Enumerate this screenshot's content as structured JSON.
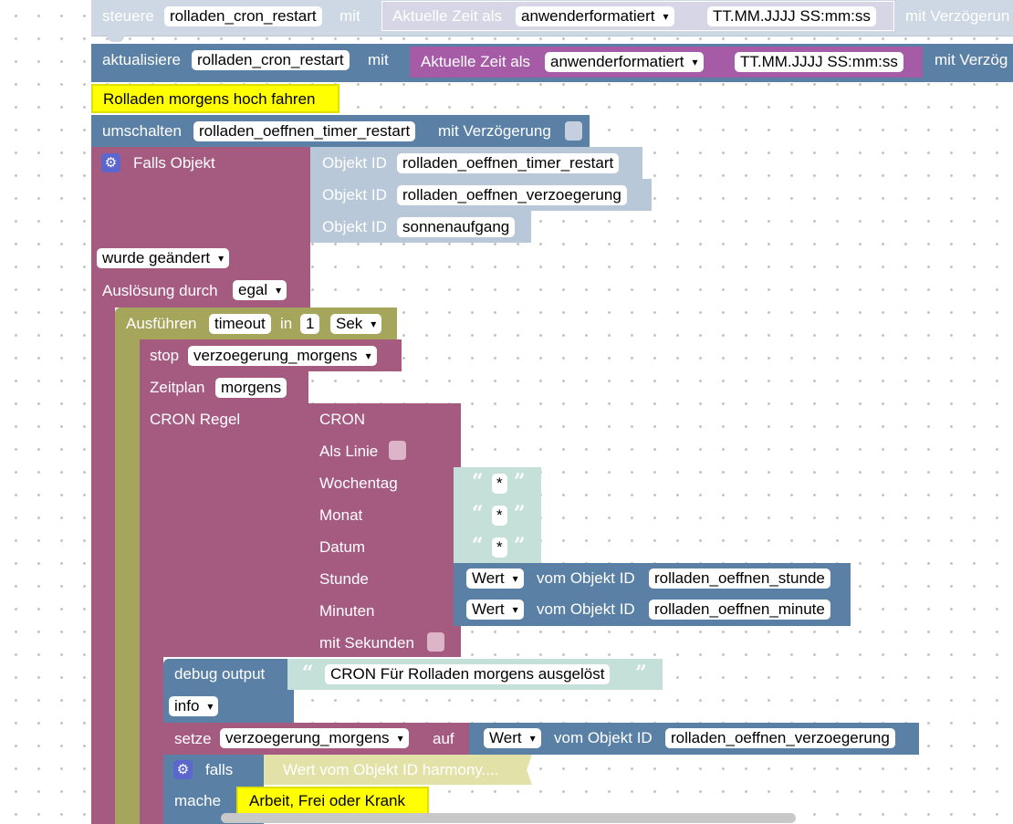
{
  "steuere_block": {
    "label": "steuere",
    "variable": "rolladen_cron_restart",
    "mit": "mit",
    "time_label": "Aktuelle Zeit als",
    "format_dropdown": "anwenderformatiert",
    "format_value": "TT.MM.JJJJ SS:mm:ss",
    "delay_label": "mit Verzögerun"
  },
  "aktualisiere_block": {
    "label": "aktualisiere",
    "variable": "rolladen_cron_restart",
    "mit": "mit",
    "time_label": "Aktuelle Zeit als",
    "format_dropdown": "anwenderformatiert",
    "format_value": "TT.MM.JJJJ SS:mm:ss",
    "delay_label": "mit Verzög"
  },
  "comment_1": "Rolladen morgens hoch fahren",
  "umschalten_block": {
    "label": "umschalten",
    "variable": "rolladen_oeffnen_timer_restart",
    "delay_label": "mit Verzögerung"
  },
  "falls_objekt_block": {
    "label": "Falls Objekt",
    "objekt_id_label": "Objekt ID",
    "ids": [
      "rolladen_oeffnen_timer_restart",
      "rolladen_oeffnen_verzoegerung",
      "sonnenaufgang"
    ],
    "trigger_dropdown": "wurde geändert",
    "ausloesung_label": "Auslösung durch",
    "ausloesung_dropdown": "egal"
  },
  "ausfuehren_block": {
    "label": "Ausführen",
    "timer_name": "timeout",
    "in_label": "in",
    "amount": "1",
    "unit_dropdown": "Sek"
  },
  "stop_block": {
    "label": "stop",
    "variable_dropdown": "verzoegerung_morgens"
  },
  "zeitplan_block": {
    "label": "Zeitplan",
    "name": "morgens",
    "cron_regel_label": "CRON Regel"
  },
  "cron_block": {
    "label": "CRON",
    "als_linie_label": "Als Linie",
    "wochentag_label": "Wochentag",
    "monat_label": "Monat",
    "datum_label": "Datum",
    "stunde_label": "Stunde",
    "minuten_label": "Minuten",
    "mit_sekunden_label": "mit Sekunden",
    "star": "*",
    "wert_dropdown": "Wert",
    "vom_objekt_label": "vom Objekt ID",
    "stunde_id": "rolladen_oeffnen_stunde",
    "minute_id": "rolladen_oeffnen_minute"
  },
  "debug_block": {
    "label": "debug output",
    "text": "CRON Für Rolladen morgens ausgelöst",
    "level_dropdown": "info"
  },
  "setze_block": {
    "label": "setze",
    "variable_dropdown": "verzoegerung_morgens",
    "auf_label": "auf",
    "wert_dropdown": "Wert",
    "vom_objekt_label": "vom Objekt ID",
    "objekt_id": "rolladen_oeffnen_verzoegerung"
  },
  "falls_block": {
    "label": "falls",
    "condition_collapsed": "Wert vom Objekt ID harmony....",
    "mache_label": "mache",
    "comment": "Arbeit, Frei oder Krank"
  },
  "colors": {
    "blue": "#5b80a5",
    "rose": "#a55b80",
    "olive": "#a5a55b",
    "purple": "#a55ba5",
    "steel": "#b8c8d8",
    "teal": "#c4e0d8",
    "comment": "#ffff00",
    "gear": "#5b67cc"
  },
  "icons": {
    "gear": "gear-icon",
    "quote_open": "“",
    "quote_close": "”"
  }
}
